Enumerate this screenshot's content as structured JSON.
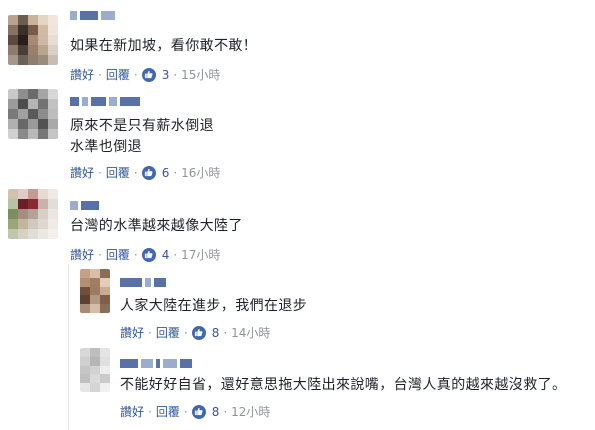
{
  "comments": [
    {
      "body": "如果在新加坡，看你敢不敢！",
      "actions": {
        "like": "讚好",
        "reply": "回覆",
        "likes": "3",
        "time": "15小時"
      },
      "colors": {
        "avatar": [
          "#b9a38e",
          "#6f5c4d",
          "#c9b29c",
          "#e5d5c5",
          "#f0e6dc",
          "#8a7161",
          "#3b2f29",
          "#7a5b4a",
          "#d0bba7",
          "#efe4da",
          "#5c4a3f",
          "#261e1a",
          "#a88a74",
          "#cdb8a5",
          "#e8ddd2",
          "#8c7b6e",
          "#4b3e36",
          "#9a806c",
          "#b9a58f",
          "#dcd0c4",
          "#a4988c",
          "#6c6259",
          "#8d7e70",
          "#9b8b7c",
          "#c8bdb2"
        ]
      }
    },
    {
      "body": "原來不是只有薪水倒退\n水準也倒退",
      "actions": {
        "like": "讚好",
        "reply": "回覆",
        "likes": "6",
        "time": "16小時"
      },
      "colors": {
        "avatar": [
          "#c9c9c9",
          "#8f8f8f",
          "#6b6b6b",
          "#a5a5a5",
          "#d8d8d8",
          "#9a9a9a",
          "#4d4d4d",
          "#b5b5b5",
          "#737373",
          "#c2c2c2",
          "#7a7a7a",
          "#a0a0a0",
          "#5a5a5a",
          "#8c8c8c",
          "#bdbdbd",
          "#b0b0b0",
          "#686868",
          "#999999",
          "#525252",
          "#a9a9a9",
          "#d0d0d0",
          "#8a8a8a",
          "#b8b8b8",
          "#777777",
          "#c5c5c5"
        ]
      }
    },
    {
      "body": "台灣的水準越來越像大陸了",
      "actions": {
        "like": "讚好",
        "reply": "回覆",
        "likes": "4",
        "time": "17小時"
      },
      "colors": {
        "avatar": [
          "#cfc3b0",
          "#e2cbc6",
          "#c49a94",
          "#e9d9d3",
          "#f1e8e4",
          "#b8c3a3",
          "#6b1f27",
          "#8c2a33",
          "#c9b2ad",
          "#e4dcd6",
          "#7f8c5e",
          "#a68d7f",
          "#b3a29a",
          "#d8cfc8",
          "#ece6e1",
          "#9aa677",
          "#c1b79f",
          "#d1c8bf",
          "#e0d8d0",
          "#efeae5",
          "#bfc6a9",
          "#d5d2c3",
          "#e2ddd4",
          "#ebe7e1",
          "#f4f1ed"
        ]
      }
    }
  ],
  "replies": [
    {
      "body": "人家大陸在進步，我們在退步",
      "actions": {
        "like": "讚好",
        "reply": "回覆",
        "likes": "8",
        "time": "14小時"
      },
      "colors": {
        "avatar": [
          "#c4a184",
          "#d9bfa7",
          "#8b6e58",
          "#b58f72",
          "#a27d62",
          "#e3cdb9",
          "#6f4f3a",
          "#9c7b62",
          "#c8ad95",
          "#5d4030",
          "#b29880",
          "#7d5f4a",
          "#a88b74",
          "#d4bca6",
          "#8a6d57"
        ]
      }
    },
    {
      "body": "不能好好自省，還好意思拖大陸出來說嘴，台灣人真的越來越沒救了。",
      "actions": {
        "like": "讚好",
        "reply": "回覆",
        "likes": "8",
        "time": "12小時"
      },
      "colors": {
        "avatar": [
          "#d8d8d8",
          "#bdbdbd",
          "#e4e4e4",
          "#cfcfcf",
          "#b5b5b5",
          "#e0e0e0",
          "#c6c6c6",
          "#d2d2d2",
          "#ededed",
          "#c0c0c0",
          "#dadada",
          "#cacaca",
          "#e6e6e6",
          "#d5d5d5",
          "#f0f0f0"
        ]
      }
    }
  ]
}
